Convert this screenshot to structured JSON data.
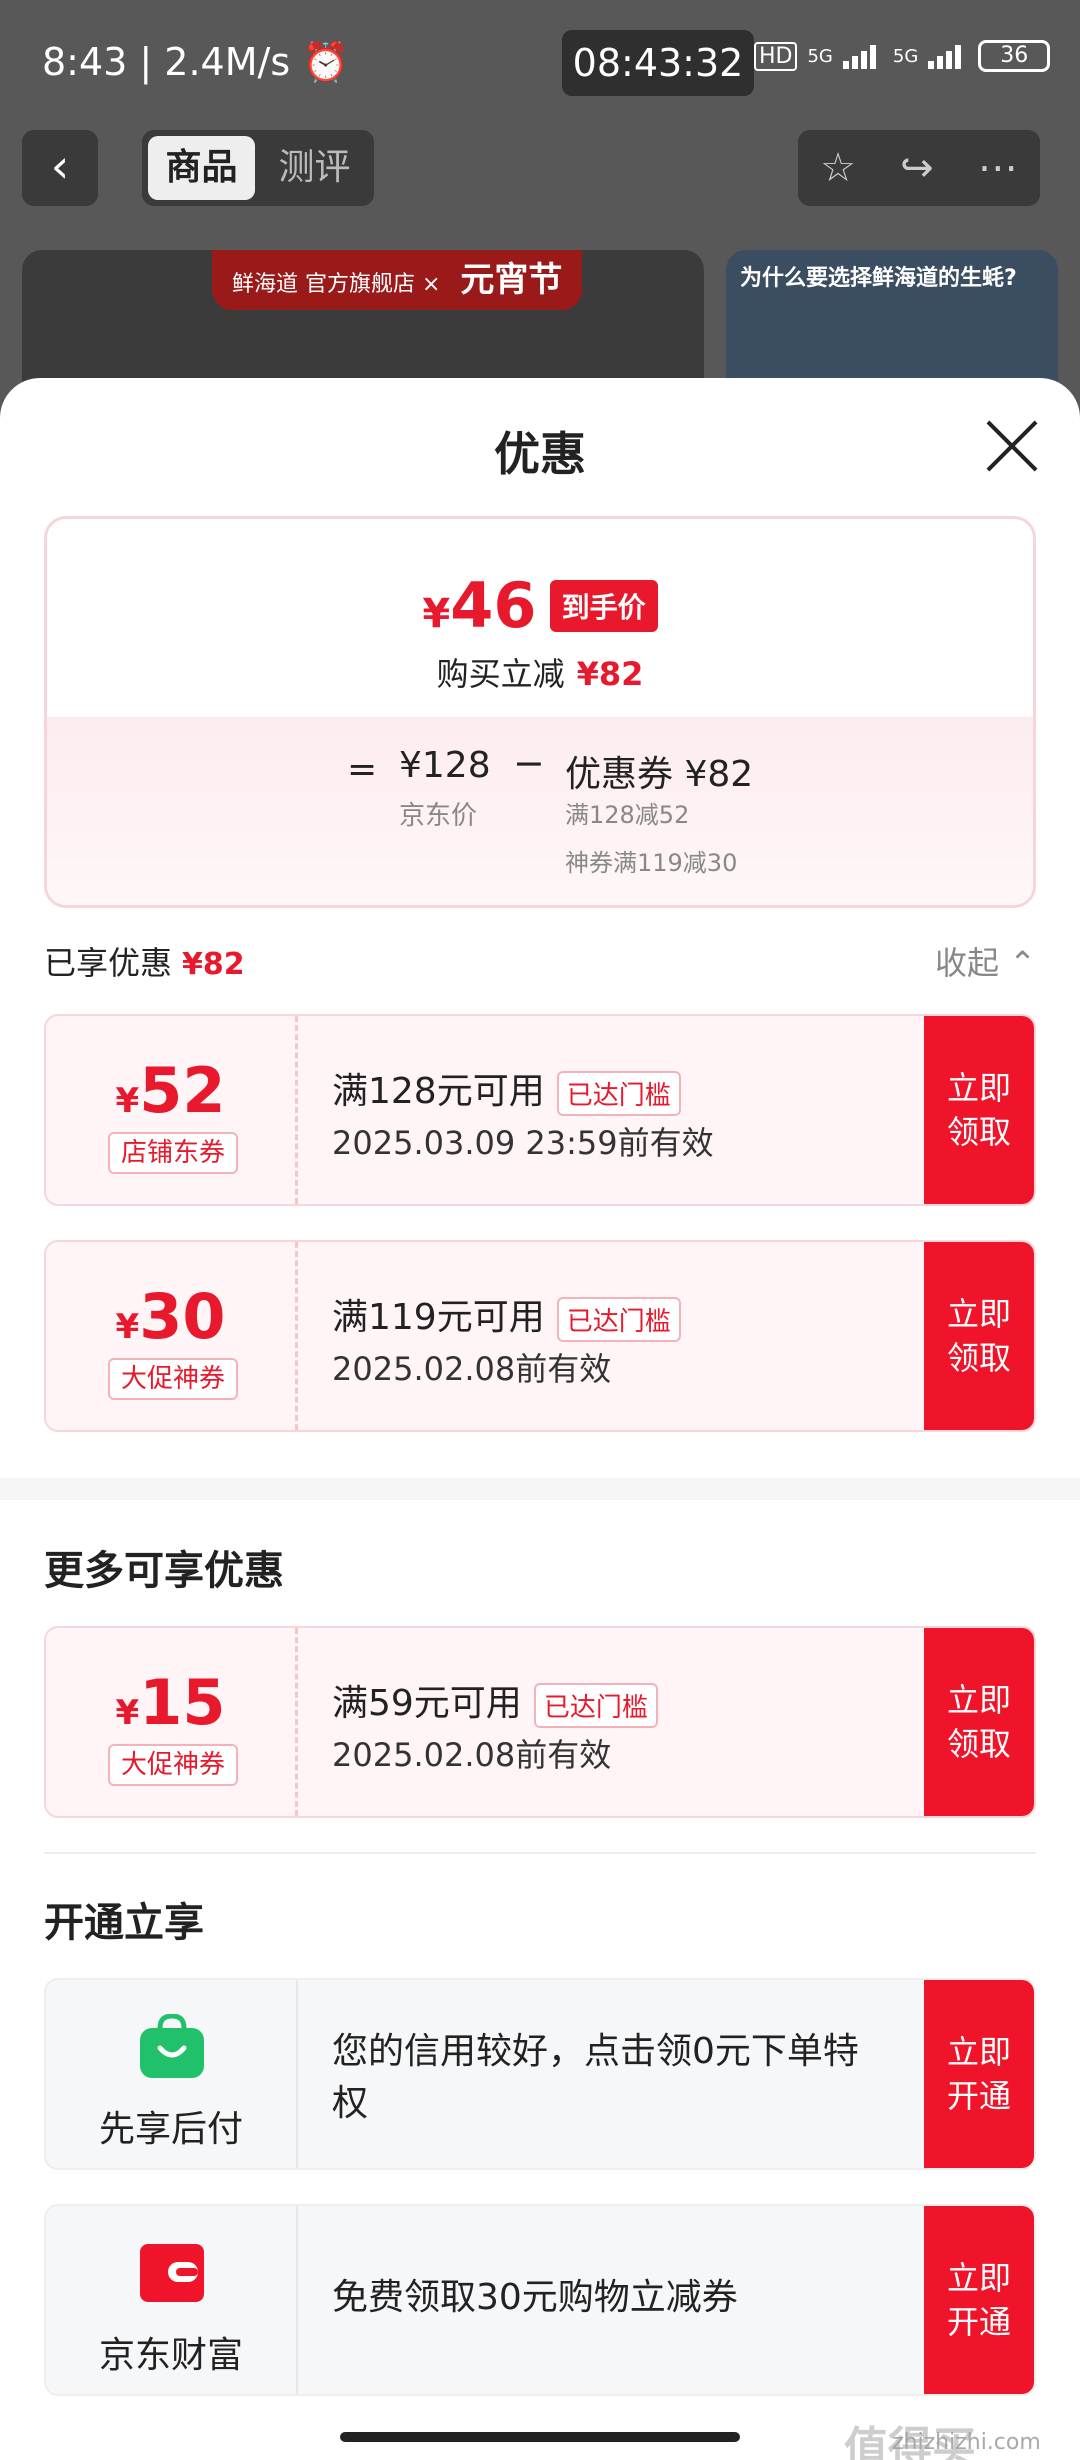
{
  "status_bar": {
    "left": "8:43 | 2.4M/s ⏰",
    "center_time": "08:43:32",
    "network_a": "HD",
    "network_b": "5G",
    "network_c": "5G",
    "battery": "36"
  },
  "nav": {
    "back_icon": "‹",
    "tabs": [
      {
        "label": "商品"
      },
      {
        "label": "测评"
      }
    ],
    "actions": [
      "☆",
      "↪",
      "⋯"
    ]
  },
  "banner": {
    "ribbon_brand": "鲜海道 官方旗舰店 ×",
    "ribbon_event": "元宵节",
    "right_title": "为什么要选择鲜海道的生蚝?"
  },
  "sheet": {
    "title": "优惠"
  },
  "price_card": {
    "currency": "¥",
    "final_price": "46",
    "final_tag": "到手价",
    "discount_label": "购买立减",
    "discount_amount": "¥82",
    "eq": "=",
    "jd_price": "¥128",
    "jd_label": "京东价",
    "minus": "−",
    "coupon_price": "优惠券 ¥82",
    "coupon_detail_1": "满128减52",
    "coupon_detail_2": "神券满119减30"
  },
  "enjoyed": {
    "label": "已享优惠",
    "amount": "¥82",
    "collapse": "收起 ⌃"
  },
  "coupons": [
    {
      "currency": "¥",
      "amount": "52",
      "type": "店铺东券",
      "condition": "满128元可用",
      "badge": "已达门槛",
      "expiry": "2025.03.09 23:59前有效",
      "button": "立即领取"
    },
    {
      "currency": "¥",
      "amount": "30",
      "type": "大促神券",
      "condition": "满119元可用",
      "badge": "已达门槛",
      "expiry": "2025.02.08前有效",
      "button": "立即领取"
    }
  ],
  "more": {
    "title": "更多可享优惠",
    "coupon": {
      "currency": "¥",
      "amount": "15",
      "type": "大促神券",
      "condition": "满59元可用",
      "badge": "已达门槛",
      "expiry": "2025.02.08前有效",
      "button": "立即领取"
    }
  },
  "open": {
    "title": "开通立享",
    "services": [
      {
        "name": "先享后付",
        "icon": "shopping-bag-icon",
        "text": "您的信用较好，点击领0元下单特权",
        "button": "立即开通",
        "color": "#21c16b"
      },
      {
        "name": "京东财富",
        "icon": "wallet-icon",
        "text": "免费领取30元购物立减券",
        "button": "立即开通",
        "color": "#f0142b"
      }
    ]
  },
  "watermark": {
    "main": "值得买",
    "sub": "zhizhizhi.com"
  },
  "colors": {
    "accent": "#e8192c",
    "button": "#f0142b"
  }
}
